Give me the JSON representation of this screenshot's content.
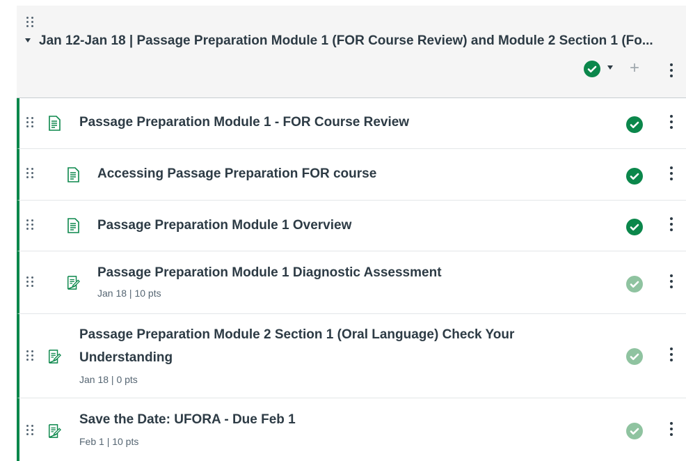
{
  "module": {
    "title": "Jan 12-Jan 18 | Passage Preparation Module 1 (FOR Course Review) and Module 2 Section 1 (Fo...",
    "published": true,
    "add_label": "+"
  },
  "items": [
    {
      "type": "page",
      "title": "Passage Preparation Module 1 - FOR Course Review",
      "meta": "",
      "indent": 0,
      "published": true
    },
    {
      "type": "page",
      "title": "Accessing Passage Preparation FOR course",
      "meta": "",
      "indent": 1,
      "published": true
    },
    {
      "type": "page",
      "title": "Passage Preparation Module 1 Overview",
      "meta": "",
      "indent": 1,
      "published": true
    },
    {
      "type": "quiz",
      "title": "Passage Preparation Module 1 Diagnostic Assessment",
      "meta": "Jan 18  |  10 pts",
      "indent": 1,
      "published": true
    },
    {
      "type": "quiz",
      "title_line1": "Passage Preparation Module 2 Section 1 (Oral Language) Check Your",
      "title_line2": "Understanding",
      "meta": "Jan 18  |  0 pts",
      "indent": 0,
      "published": true
    },
    {
      "type": "quiz",
      "title": "Save the Date: UFORA - Due Feb 1",
      "meta": "Feb 1  |  10 pts",
      "indent": 0,
      "published": true
    }
  ],
  "colors": {
    "accent": "#0b874b",
    "accent_muted": "#8fc3a0",
    "text": "#2d3b45",
    "header_bg": "#f5f5f5"
  },
  "icons": {
    "page": "document-icon",
    "quiz": "quiz-icon",
    "drag": "drag-handle-icon",
    "publish": "published-check-icon",
    "menu": "kebab-menu-icon"
  }
}
